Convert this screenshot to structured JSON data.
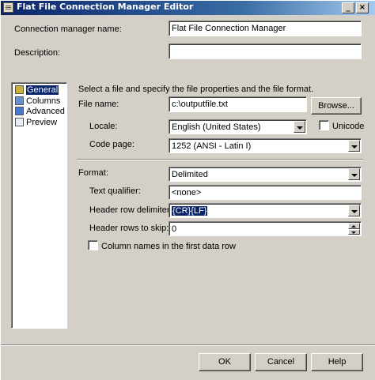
{
  "window": {
    "title": "Flat File Connection Manager Editor"
  },
  "connection": {
    "name_label": "Connection manager name:",
    "name_value": "Flat File Connection Manager"
  },
  "description": {
    "label": "Description:",
    "value": ""
  },
  "sidebar": {
    "items": [
      {
        "label": "General",
        "icon": "general-icon",
        "selected": true
      },
      {
        "label": "Columns",
        "icon": "columns-icon",
        "selected": false
      },
      {
        "label": "Advanced",
        "icon": "advanced-icon",
        "selected": false
      },
      {
        "label": "Preview",
        "icon": "preview-icon",
        "selected": false
      }
    ]
  },
  "general": {
    "instruction": "Select a file and specify the file properties and the file format.",
    "file_name_label": "File name:",
    "file_name_value": "c:\\outputfile.txt",
    "browse_label": "Browse...",
    "locale_label": "Locale:",
    "locale_value": "English (United States)",
    "unicode_label": "Unicode",
    "code_page_label": "Code page:",
    "code_page_value": "1252  (ANSI - Latin I)",
    "format_label": "Format:",
    "format_value": "Delimited",
    "text_qualifier_label": "Text qualifier:",
    "text_qualifier_value": "<none>",
    "header_row_delimiter_label": "Header row delimiter:",
    "header_row_delimiter_value": "{CR}{LF}",
    "header_rows_to_skip_label": "Header rows to skip:",
    "header_rows_to_skip_value": "0",
    "column_names_label": "Column names in the first data row"
  },
  "footer": {
    "ok_label": "OK",
    "cancel_label": "Cancel",
    "help_label": "Help"
  },
  "colors": {
    "title_gradient_start": "#0a246a",
    "face": "#d4d0c8",
    "selection": "#0a246a"
  }
}
